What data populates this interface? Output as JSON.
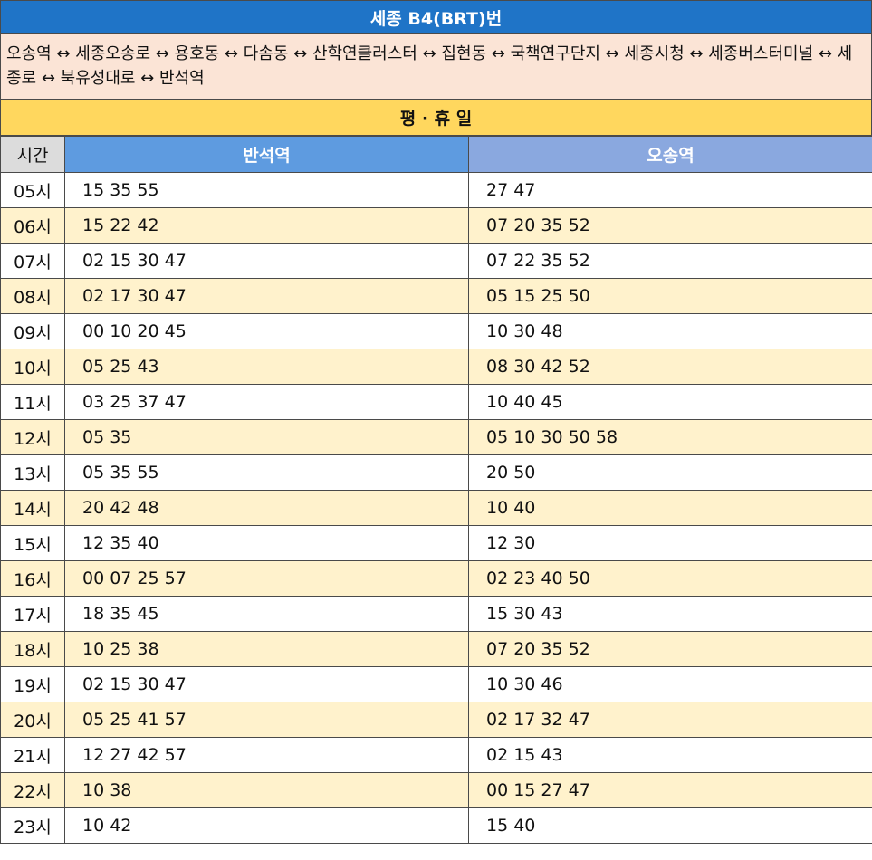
{
  "title": "세종 B4(BRT)번",
  "route": "오송역 ↔ 세종오송로 ↔ 용호동 ↔ 다솜동 ↔ 산학연클러스터 ↔ 집현동 ↔ 국책연구단지 ↔ 세종시청 ↔ 세종버스터미널 ↔ 세종로 ↔ 북유성대로 ↔ 반석역",
  "section": "평 · 휴 일",
  "headers": {
    "hour": "시간",
    "dir_a": "반석역",
    "dir_b": "오송역"
  },
  "rows": [
    {
      "hour": "05시",
      "a": "15 35 55",
      "b": "27 47"
    },
    {
      "hour": "06시",
      "a": "15 22 42",
      "b": "07 20 35 52"
    },
    {
      "hour": "07시",
      "a": "02 15 30 47",
      "b": "07 22 35 52"
    },
    {
      "hour": "08시",
      "a": "02 17 30 47",
      "b": "05 15 25 50"
    },
    {
      "hour": "09시",
      "a": "00 10 20 45",
      "b": "10 30 48"
    },
    {
      "hour": "10시",
      "a": "05 25 43",
      "b": "08 30 42 52"
    },
    {
      "hour": "11시",
      "a": "03 25 37 47",
      "b": "10 40 45"
    },
    {
      "hour": "12시",
      "a": "05 35",
      "b": "05 10 30 50 58"
    },
    {
      "hour": "13시",
      "a": "05 35 55",
      "b": "20 50"
    },
    {
      "hour": "14시",
      "a": "20 42 48",
      "b": "10 40"
    },
    {
      "hour": "15시",
      "a": "12 35 40",
      "b": "12 30"
    },
    {
      "hour": "16시",
      "a": "00 07 25 57",
      "b": "02 23 40 50"
    },
    {
      "hour": "17시",
      "a": "18 35 45",
      "b": "15 30 43"
    },
    {
      "hour": "18시",
      "a": "10 25 38",
      "b": "07 20 35 52"
    },
    {
      "hour": "19시",
      "a": "02 15 30 47",
      "b": "10 30 46"
    },
    {
      "hour": "20시",
      "a": "05 25 41 57",
      "b": "02 17 32 47"
    },
    {
      "hour": "21시",
      "a": "12 27 42 57",
      "b": "02 15 43"
    },
    {
      "hour": "22시",
      "a": "10 38",
      "b": "00 15 27 47"
    },
    {
      "hour": "23시",
      "a": "10 42",
      "b": "15 40"
    }
  ]
}
